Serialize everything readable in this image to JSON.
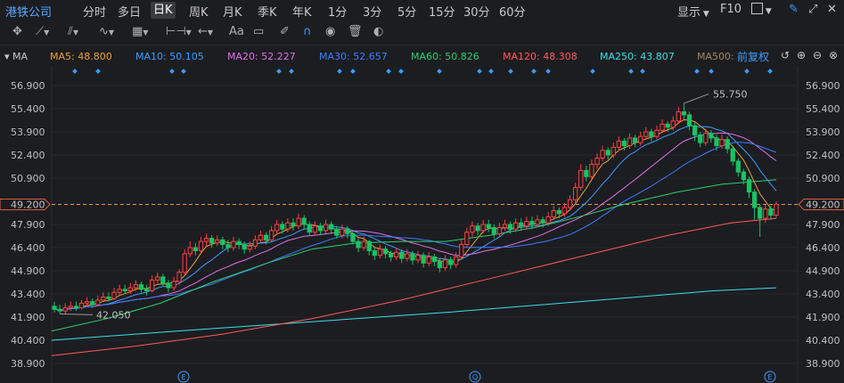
{
  "topbar": {
    "stock_name": "港铁公司",
    "periods": [
      "分时",
      "多日",
      "日K",
      "周K",
      "月K",
      "季K",
      "年K",
      "1分",
      "3分",
      "5分",
      "15分",
      "30分",
      "60分"
    ],
    "active_period": "日K",
    "display_label": "显示",
    "f10_label": "F10"
  },
  "toolbar": {
    "text_tool_label": "Aa"
  },
  "ma_bar": {
    "toggle_label": "MA",
    "items": [
      {
        "label": "MA5: 48.800",
        "color": "#e8a23a"
      },
      {
        "label": "MA10: 50.105",
        "color": "#3b9dff"
      },
      {
        "label": "MA20: 52.227",
        "color": "#e070e8"
      },
      {
        "label": "MA30: 52.657",
        "color": "#3b7cff"
      },
      {
        "label": "MA60: 50.826",
        "color": "#2ecf6e"
      },
      {
        "label": "MA120: 48.308",
        "color": "#ff5a5a"
      },
      {
        "label": "MA250: 43.807",
        "color": "#3ae0e8"
      },
      {
        "label": "MA500: ",
        "color": "#a08858"
      }
    ],
    "adjust_label": "前复权"
  },
  "chart_data": {
    "type": "candlestick",
    "y_ticks": [
      "56.900",
      "55.400",
      "53.900",
      "52.400",
      "50.900",
      "49.200",
      "47.900",
      "46.400",
      "44.900",
      "43.400",
      "41.900",
      "40.400",
      "38.900"
    ],
    "ylim": [
      38.9,
      56.9
    ],
    "current_price": "49.200",
    "annotations": [
      {
        "label": "55.750",
        "value": 55.75
      },
      {
        "label": "42.050",
        "value": 42.05
      }
    ],
    "event_markers": [
      "E",
      "Q",
      "E"
    ],
    "colors": {
      "up": "#ff4040",
      "down": "#19c364"
    },
    "candles": [
      [
        42.6,
        42.4,
        42.9,
        42.2
      ],
      [
        42.4,
        42.3,
        42.7,
        42.1
      ],
      [
        42.3,
        42.5,
        42.8,
        42.1
      ],
      [
        42.5,
        42.6,
        42.9,
        42.3
      ],
      [
        42.6,
        42.5,
        42.9,
        42.3
      ],
      [
        42.5,
        42.8,
        43.0,
        42.4
      ],
      [
        42.8,
        42.9,
        43.2,
        42.6
      ],
      [
        42.9,
        42.7,
        43.1,
        42.5
      ],
      [
        42.7,
        43.0,
        43.3,
        42.6
      ],
      [
        43.0,
        43.2,
        43.5,
        42.9
      ],
      [
        43.2,
        43.1,
        43.5,
        42.9
      ],
      [
        43.1,
        43.5,
        43.8,
        43.0
      ],
      [
        43.5,
        43.7,
        44.0,
        43.3
      ],
      [
        43.7,
        43.6,
        44.0,
        43.4
      ],
      [
        43.6,
        43.8,
        44.1,
        43.4
      ],
      [
        43.8,
        44.0,
        44.3,
        43.6
      ],
      [
        44.0,
        43.7,
        44.2,
        43.5
      ],
      [
        43.7,
        43.6,
        44.0,
        43.3
      ],
      [
        43.6,
        44.3,
        44.6,
        43.5
      ],
      [
        44.3,
        44.5,
        44.8,
        44.1
      ],
      [
        44.5,
        44.1,
        44.7,
        43.9
      ],
      [
        44.1,
        43.8,
        44.3,
        43.5
      ],
      [
        43.8,
        44.2,
        44.5,
        43.6
      ],
      [
        44.2,
        44.8,
        45.0,
        44.0
      ],
      [
        44.8,
        46.0,
        46.3,
        44.6
      ],
      [
        46.0,
        46.4,
        46.8,
        45.8
      ],
      [
        46.4,
        46.2,
        46.7,
        45.9
      ],
      [
        46.2,
        46.8,
        47.1,
        46.0
      ],
      [
        46.8,
        47.0,
        47.3,
        46.5
      ],
      [
        47.0,
        46.7,
        47.2,
        46.4
      ],
      [
        46.7,
        46.9,
        47.2,
        46.5
      ],
      [
        46.9,
        46.6,
        47.1,
        46.3
      ],
      [
        46.6,
        46.4,
        46.9,
        46.1
      ],
      [
        46.4,
        46.8,
        47.1,
        46.2
      ],
      [
        46.8,
        46.6,
        47.0,
        46.3
      ],
      [
        46.6,
        46.3,
        46.8,
        46.0
      ],
      [
        46.3,
        46.5,
        46.8,
        46.1
      ],
      [
        46.5,
        46.9,
        47.2,
        46.3
      ],
      [
        46.9,
        47.2,
        47.5,
        46.7
      ],
      [
        47.2,
        46.9,
        47.4,
        46.6
      ],
      [
        46.9,
        47.5,
        47.8,
        46.8
      ],
      [
        47.5,
        47.9,
        48.2,
        47.3
      ],
      [
        47.9,
        47.6,
        48.1,
        47.3
      ],
      [
        47.6,
        48.0,
        48.3,
        47.4
      ],
      [
        48.0,
        47.8,
        48.3,
        47.5
      ],
      [
        47.8,
        48.3,
        48.6,
        47.6
      ],
      [
        48.3,
        47.9,
        48.5,
        47.6
      ],
      [
        47.9,
        47.4,
        48.1,
        47.2
      ],
      [
        47.4,
        47.8,
        48.1,
        47.2
      ],
      [
        47.8,
        47.5,
        48.0,
        47.2
      ],
      [
        47.5,
        47.9,
        48.2,
        47.3
      ],
      [
        47.9,
        47.6,
        48.1,
        47.3
      ],
      [
        47.6,
        47.2,
        47.8,
        47.0
      ],
      [
        47.2,
        47.6,
        47.9,
        47.0
      ],
      [
        47.6,
        47.3,
        47.8,
        47.0
      ],
      [
        47.3,
        46.8,
        47.5,
        46.6
      ],
      [
        46.8,
        46.4,
        47.0,
        46.1
      ],
      [
        46.4,
        46.8,
        47.1,
        46.2
      ],
      [
        46.8,
        46.2,
        46.9,
        45.9
      ],
      [
        46.2,
        45.9,
        46.4,
        45.6
      ],
      [
        45.9,
        46.3,
        46.6,
        45.7
      ],
      [
        46.3,
        46.0,
        46.5,
        45.7
      ],
      [
        46.0,
        45.8,
        46.2,
        45.5
      ],
      [
        45.8,
        46.1,
        46.4,
        45.6
      ],
      [
        46.1,
        45.7,
        46.3,
        45.4
      ],
      [
        45.7,
        46.0,
        46.3,
        45.5
      ],
      [
        46.0,
        45.6,
        46.2,
        45.3
      ],
      [
        45.6,
        45.9,
        46.2,
        45.4
      ],
      [
        45.9,
        45.4,
        46.1,
        45.1
      ],
      [
        45.4,
        45.8,
        46.1,
        45.2
      ],
      [
        45.8,
        45.5,
        46.0,
        45.2
      ],
      [
        45.5,
        45.1,
        45.7,
        44.8
      ],
      [
        45.1,
        45.6,
        45.9,
        44.9
      ],
      [
        45.6,
        45.3,
        45.8,
        45.0
      ],
      [
        45.3,
        45.8,
        46.1,
        45.1
      ],
      [
        45.8,
        46.6,
        46.9,
        45.6
      ],
      [
        46.6,
        47.4,
        47.7,
        46.4
      ],
      [
        47.4,
        47.8,
        48.1,
        47.1
      ],
      [
        47.8,
        47.5,
        48.0,
        47.2
      ],
      [
        47.5,
        47.9,
        48.2,
        47.3
      ],
      [
        47.9,
        47.7,
        48.2,
        47.4
      ],
      [
        47.7,
        47.3,
        47.9,
        47.0
      ],
      [
        47.3,
        47.7,
        48.0,
        47.1
      ],
      [
        47.7,
        47.9,
        48.2,
        47.5
      ],
      [
        47.9,
        47.6,
        48.1,
        47.3
      ],
      [
        47.6,
        48.0,
        48.3,
        47.4
      ],
      [
        48.0,
        47.8,
        48.3,
        47.5
      ],
      [
        47.8,
        48.1,
        48.4,
        47.6
      ],
      [
        48.1,
        47.9,
        48.4,
        47.6
      ],
      [
        47.9,
        48.2,
        48.5,
        47.7
      ],
      [
        48.2,
        48.0,
        48.4,
        47.7
      ],
      [
        48.0,
        48.4,
        48.7,
        47.8
      ],
      [
        48.4,
        48.8,
        49.1,
        48.2
      ],
      [
        48.8,
        48.6,
        49.0,
        48.3
      ],
      [
        48.6,
        49.0,
        49.3,
        48.4
      ],
      [
        49.0,
        49.5,
        49.8,
        48.8
      ],
      [
        49.5,
        50.3,
        50.6,
        49.3
      ],
      [
        50.3,
        51.4,
        51.8,
        50.1
      ],
      [
        51.4,
        51.0,
        51.7,
        50.7
      ],
      [
        51.0,
        51.8,
        52.1,
        50.8
      ],
      [
        51.8,
        52.2,
        52.5,
        51.5
      ],
      [
        52.2,
        52.7,
        53.0,
        52.0
      ],
      [
        52.7,
        52.4,
        52.9,
        52.1
      ],
      [
        52.4,
        52.9,
        53.2,
        52.2
      ],
      [
        52.9,
        53.3,
        53.6,
        52.7
      ],
      [
        53.3,
        53.0,
        53.5,
        52.7
      ],
      [
        53.0,
        53.5,
        53.8,
        52.8
      ],
      [
        53.5,
        53.2,
        53.7,
        52.9
      ],
      [
        53.2,
        53.6,
        53.9,
        53.0
      ],
      [
        53.6,
        53.9,
        54.2,
        53.4
      ],
      [
        53.9,
        53.6,
        54.1,
        53.3
      ],
      [
        53.6,
        54.0,
        54.3,
        53.4
      ],
      [
        54.0,
        54.4,
        54.7,
        53.8
      ],
      [
        54.4,
        54.2,
        54.6,
        53.9
      ],
      [
        54.2,
        54.6,
        54.9,
        54.0
      ],
      [
        54.6,
        55.2,
        55.5,
        54.4
      ],
      [
        55.2,
        55.0,
        55.75,
        54.7
      ],
      [
        55.0,
        54.3,
        55.2,
        54.0
      ],
      [
        54.3,
        53.7,
        54.5,
        53.3
      ],
      [
        53.7,
        53.2,
        53.9,
        52.9
      ],
      [
        53.2,
        53.8,
        54.1,
        53.0
      ],
      [
        53.8,
        53.5,
        54.0,
        53.2
      ],
      [
        53.5,
        53.0,
        53.7,
        52.7
      ],
      [
        53.0,
        53.4,
        53.7,
        52.8
      ],
      [
        53.4,
        52.8,
        53.6,
        52.5
      ],
      [
        52.8,
        52.0,
        53.0,
        51.7
      ],
      [
        52.0,
        51.3,
        52.2,
        51.0
      ],
      [
        51.3,
        50.8,
        51.5,
        50.5
      ],
      [
        50.8,
        50.0,
        51.0,
        49.6
      ],
      [
        50.0,
        49.0,
        50.2,
        48.2
      ],
      [
        49.0,
        48.3,
        49.2,
        47.1
      ],
      [
        48.3,
        48.9,
        49.2,
        48.0
      ],
      [
        48.9,
        48.5,
        49.1,
        48.2
      ],
      [
        48.5,
        49.2,
        49.4,
        48.3
      ]
    ]
  }
}
